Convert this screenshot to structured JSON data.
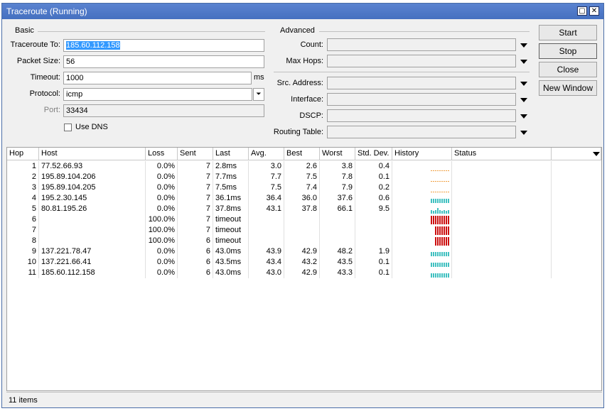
{
  "window": {
    "title": "Traceroute (Running)"
  },
  "basic": {
    "group_label": "Basic",
    "traceroute_to_label": "Traceroute To:",
    "traceroute_to_value": "185.60.112.158",
    "packet_size_label": "Packet Size:",
    "packet_size_value": "56",
    "timeout_label": "Timeout:",
    "timeout_value": "1000",
    "timeout_unit": "ms",
    "protocol_label": "Protocol:",
    "protocol_value": "icmp",
    "port_label": "Port:",
    "port_value": "33434",
    "use_dns_label": "Use DNS"
  },
  "advanced": {
    "group_label": "Advanced",
    "count_label": "Count:",
    "max_hops_label": "Max Hops:",
    "src_address_label": "Src. Address:",
    "interface_label": "Interface:",
    "dscp_label": "DSCP:",
    "routing_table_label": "Routing Table:"
  },
  "buttons": {
    "start": "Start",
    "stop": "Stop",
    "close": "Close",
    "new_window": "New Window"
  },
  "table": {
    "columns": [
      "Hop",
      "Host",
      "Loss",
      "Sent",
      "Last",
      "Avg.",
      "Best",
      "Worst",
      "Std. Dev.",
      "History",
      "Status"
    ],
    "rows": [
      {
        "hop": "1",
        "host": "77.52.66.93",
        "loss": "0.0%",
        "sent": "7",
        "last": "2.8ms",
        "avg": "3.0",
        "best": "2.6",
        "worst": "3.8",
        "std": "0.4",
        "history": "low"
      },
      {
        "hop": "2",
        "host": "195.89.104.206",
        "loss": "0.0%",
        "sent": "7",
        "last": "7.7ms",
        "avg": "7.7",
        "best": "7.5",
        "worst": "7.8",
        "std": "0.1",
        "history": "low"
      },
      {
        "hop": "3",
        "host": "195.89.104.205",
        "loss": "0.0%",
        "sent": "7",
        "last": "7.5ms",
        "avg": "7.5",
        "best": "7.4",
        "worst": "7.9",
        "std": "0.2",
        "history": "low"
      },
      {
        "hop": "4",
        "host": "195.2.30.145",
        "loss": "0.0%",
        "sent": "7",
        "last": "36.1ms",
        "avg": "36.4",
        "best": "36.0",
        "worst": "37.6",
        "std": "0.6",
        "history": "mid"
      },
      {
        "hop": "5",
        "host": "80.81.195.26",
        "loss": "0.0%",
        "sent": "7",
        "last": "37.8ms",
        "avg": "43.1",
        "best": "37.8",
        "worst": "66.1",
        "std": "9.5",
        "history": "mixed"
      },
      {
        "hop": "6",
        "host": "",
        "loss": "100.0%",
        "sent": "7",
        "last": "timeout",
        "avg": "",
        "best": "",
        "worst": "",
        "std": "",
        "history": "loss"
      },
      {
        "hop": "7",
        "host": "",
        "loss": "100.0%",
        "sent": "7",
        "last": "timeout",
        "avg": "",
        "best": "",
        "worst": "",
        "std": "",
        "history": "loss"
      },
      {
        "hop": "8",
        "host": "",
        "loss": "100.0%",
        "sent": "6",
        "last": "timeout",
        "avg": "",
        "best": "",
        "worst": "",
        "std": "",
        "history": "loss"
      },
      {
        "hop": "9",
        "host": "137.221.78.47",
        "loss": "0.0%",
        "sent": "6",
        "last": "43.0ms",
        "avg": "43.9",
        "best": "42.9",
        "worst": "48.2",
        "std": "1.9",
        "history": "mid"
      },
      {
        "hop": "10",
        "host": "137.221.66.41",
        "loss": "0.0%",
        "sent": "6",
        "last": "43.5ms",
        "avg": "43.4",
        "best": "43.2",
        "worst": "43.5",
        "std": "0.1",
        "history": "mid"
      },
      {
        "hop": "11",
        "host": "185.60.112.158",
        "loss": "0.0%",
        "sent": "6",
        "last": "43.0ms",
        "avg": "43.0",
        "best": "42.9",
        "worst": "43.3",
        "std": "0.1",
        "history": "mid"
      }
    ]
  },
  "statusbar": {
    "items": "11 items"
  },
  "colors": {
    "history_low": "#f0a040",
    "history_ok": "#40c0c0",
    "history_loss": "#cc1010",
    "titlebar": "#4f78c4"
  }
}
